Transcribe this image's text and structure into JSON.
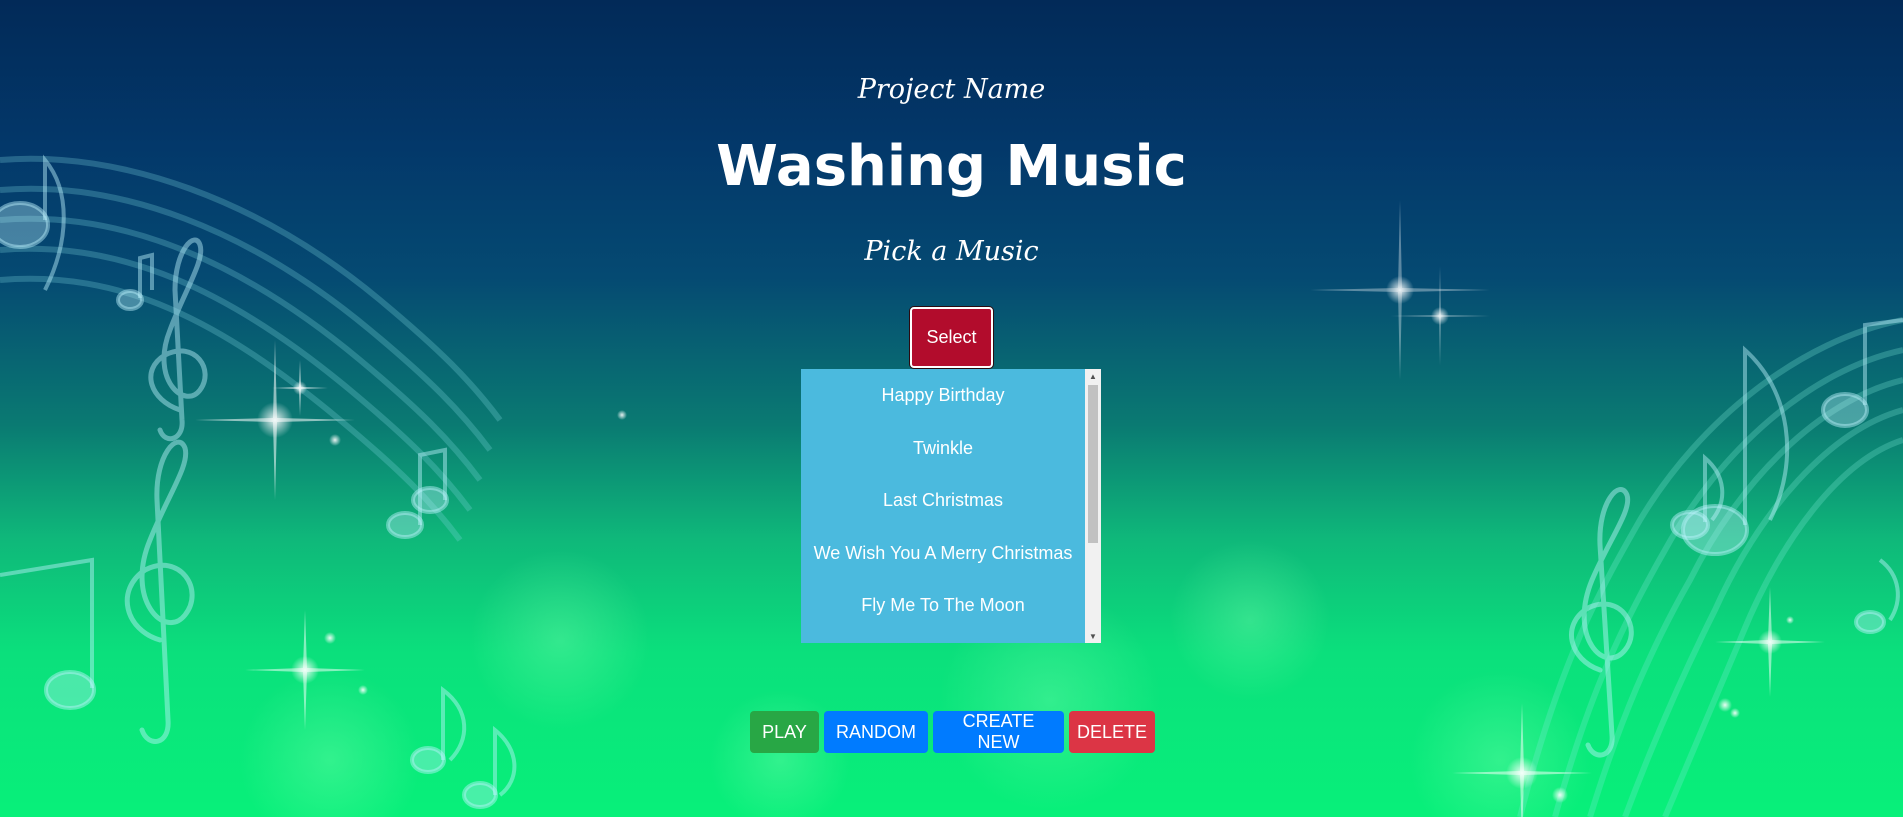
{
  "header": {
    "project_name": "Project Name",
    "title": "Washing Music",
    "subtitle": "Pick a Music"
  },
  "select_button": {
    "label": "Select",
    "color": "#b20c2c"
  },
  "dropdown": {
    "items": [
      "Happy Birthday",
      "Twinkle",
      "Last Christmas",
      "We Wish You A Merry Christmas",
      "Fly Me To The Moon"
    ],
    "background": "#4bbade"
  },
  "actions": {
    "play": "PLAY",
    "random": "RANDOM",
    "create_new": "CREATE NEW",
    "delete": "DELETE"
  },
  "colors": {
    "play": "#28a745",
    "primary": "#007bff",
    "danger": "#dc3545"
  },
  "background": {
    "description_icons": [
      "music-note-icon",
      "treble-clef-icon",
      "sparkle-icon",
      "staff-lines"
    ]
  }
}
